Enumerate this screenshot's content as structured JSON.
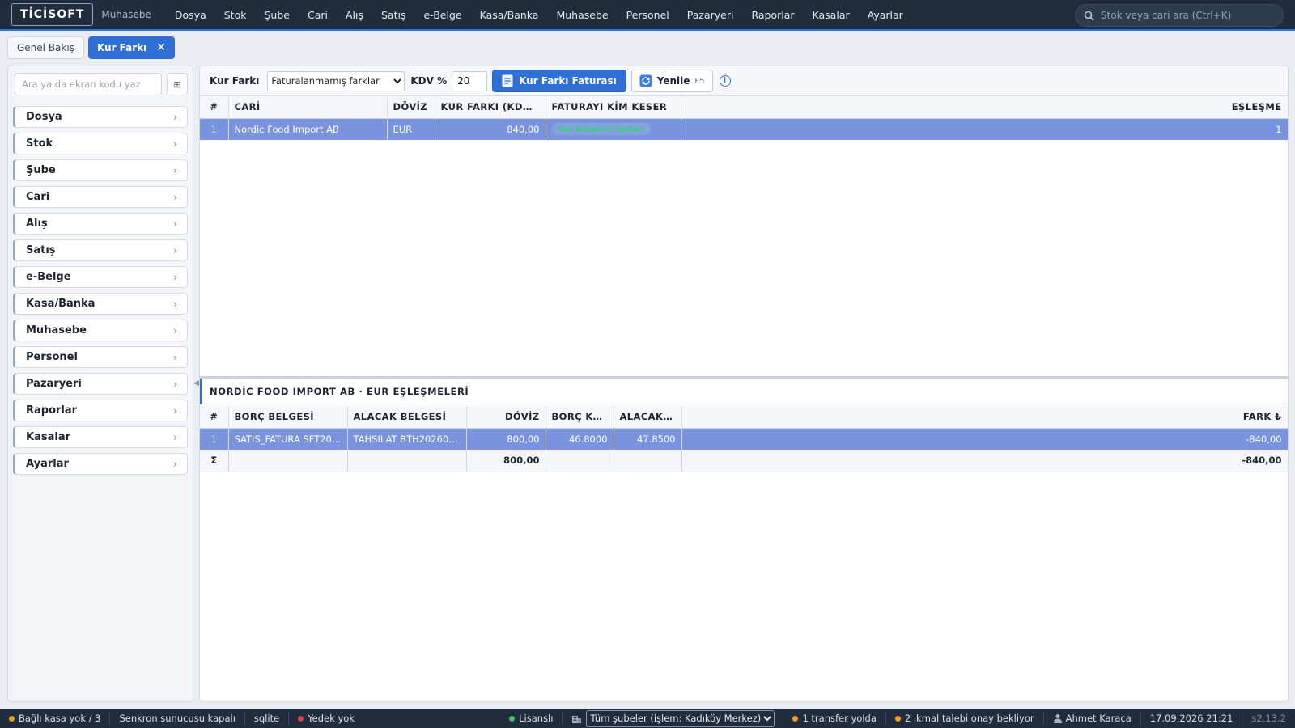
{
  "header": {
    "logo": "TİCİSOFT",
    "module": "Muhasebe",
    "menu": [
      "Dosya",
      "Stok",
      "Şube",
      "Cari",
      "Alış",
      "Satış",
      "e-Belge",
      "Kasa/Banka",
      "Muhasebe",
      "Personel",
      "Pazaryeri",
      "Raporlar",
      "Kasalar",
      "Ayarlar"
    ],
    "search_placeholder": "Stok veya cari ara (Ctrl+K)"
  },
  "tabs": [
    {
      "label": "Genel Bakış",
      "active": false
    },
    {
      "label": "Kur Farkı",
      "active": true,
      "close": "✕"
    }
  ],
  "sidebar": {
    "search_placeholder": "Ara ya da ekran kodu yaz",
    "grid_button": "⊞",
    "items": [
      "Dosya",
      "Stok",
      "Şube",
      "Cari",
      "Alış",
      "Satış",
      "e-Belge",
      "Kasa/Banka",
      "Muhasebe",
      "Personel",
      "Pazaryeri",
      "Raporlar",
      "Kasalar",
      "Ayarlar"
    ]
  },
  "toolbar": {
    "title": "Kur Farkı",
    "filter_selected": "Faturalanmamış farklar",
    "kdv_label": "KDV %",
    "kdv_value": "20",
    "invoice_button": "Kur Farkı Faturası",
    "refresh_button": "Yenile",
    "refresh_shortcut": "F5",
    "info": "i"
  },
  "grid1": {
    "columns": [
      "#",
      "CARİ",
      "DÖVİZ",
      "KUR FARKI (KDV ...",
      "FATURAYI KİM KESER",
      "EŞLEŞME"
    ],
    "rows": [
      {
        "idx": "1",
        "cari": "Nordic Food Import AB",
        "doviz": "EUR",
        "kur_farki": "840,00",
        "kim_keser": "biz keseriz (lehe)",
        "eslesme": "1"
      }
    ]
  },
  "detail": {
    "title": "NORDİC FOOD IMPORT AB · EUR EŞLEŞMELERİ",
    "columns": [
      "#",
      "BORÇ BELGESİ",
      "ALACAK BELGESİ",
      "DÖVİZ",
      "BORÇ KU...",
      "ALACAK ...",
      "FARK ₺"
    ],
    "rows": [
      {
        "idx": "1",
        "borc_belgesi": "SATIS_FATURA SFT2026...",
        "alacak_belgesi": "TAHSILAT BTH20260000...",
        "doviz": "800,00",
        "borc_kur": "46.8000",
        "alacak_kur": "47.8500",
        "fark": "-840,00"
      }
    ],
    "sum": {
      "symbol": "Σ",
      "doviz": "800,00",
      "fark": "-840,00"
    }
  },
  "statusbar": {
    "kasa": "Bağlı kasa yok / 3",
    "sync": "Senkron sunucusu kapalı",
    "db": "sqlite",
    "backup": "Yedek yok",
    "license": "Lisanslı",
    "branch_selected": "Tüm şubeler (işlem: Kadıköy Merkez)",
    "transfer": "1 transfer yolda",
    "ikmal": "2 ikmal talebi onay bekliyor",
    "user": "Ahmet Karaca",
    "datetime": "17.09.2026 21:21",
    "version": "s2.13.2"
  },
  "colors": {
    "topbar": "#1f2d3d",
    "accent": "#2f6fd6",
    "selected_row": "#7a93de",
    "status_ok": "#3fbf5f",
    "status_warn": "#f0a020",
    "status_error": "#e04040"
  },
  "icons": {
    "search": "search-icon",
    "invoice": "invoice-icon",
    "refresh": "refresh-icon",
    "building": "building-icon",
    "user": "user-icon"
  }
}
